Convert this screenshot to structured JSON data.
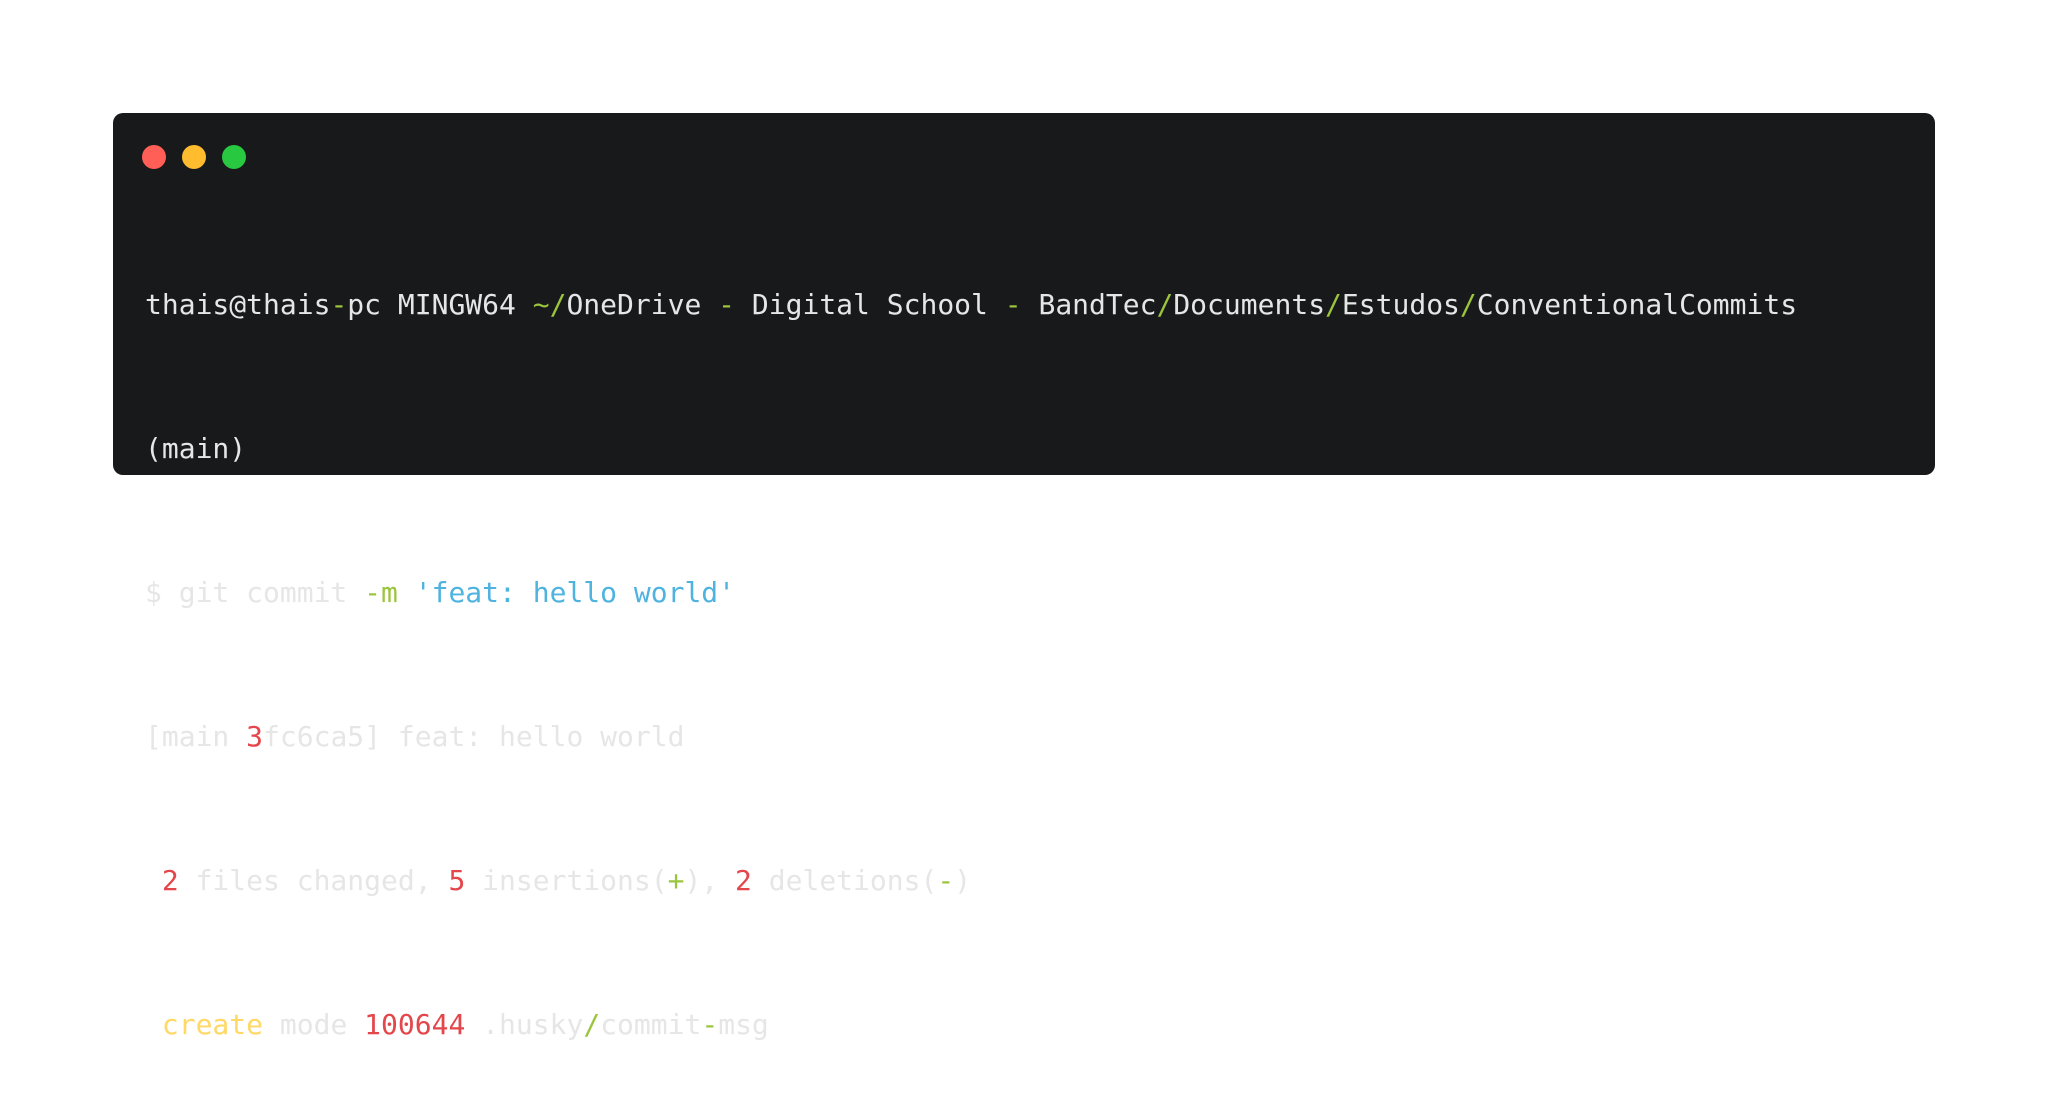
{
  "colors": {
    "terminal_bg": "#18191b",
    "text": "#e6e6e6",
    "operator_green": "#9bc53d",
    "string_blue": "#4fb3e0",
    "number_red": "#e3464b",
    "keyword_yellow": "#ffd866",
    "dot_red": "#ff5f57",
    "dot_yellow": "#febc2e",
    "dot_green": "#28c840"
  },
  "terminal": {
    "line1": {
      "p1": "thais@thais",
      "p2": "-",
      "p3": "pc MINGW64 ",
      "p4": "~/",
      "p5": "OneDrive ",
      "p6": "-",
      "p7": " Digital School ",
      "p8": "-",
      "p9": " BandTec",
      "p10": "/",
      "p11": "Documents",
      "p12": "/",
      "p13": "Estudos",
      "p14": "/",
      "p15": "ConventionalCommits"
    },
    "line2": "(main)",
    "line3": {
      "prompt": "$ git commit ",
      "flag": "-m",
      "space": " ",
      "message": "'feat: hello world'"
    },
    "line4": {
      "p1": "[main ",
      "p2": "3",
      "p3": "fc6ca5] feat: hello world"
    },
    "line5": {
      "p1": " ",
      "files": "2",
      "p2": " files changed, ",
      "insertions": "5",
      "p3": " insertions(",
      "plus": "+",
      "p4": "), ",
      "deletions": "2",
      "p5": " deletions(",
      "minus": "-",
      "p6": ")"
    },
    "line6": {
      "p1": " ",
      "create": "create",
      "p2": " mode ",
      "mode": "100644",
      "p3": " .husky",
      "slash": "/",
      "p4": "commit",
      "dash": "-",
      "p5": "msg"
    }
  }
}
